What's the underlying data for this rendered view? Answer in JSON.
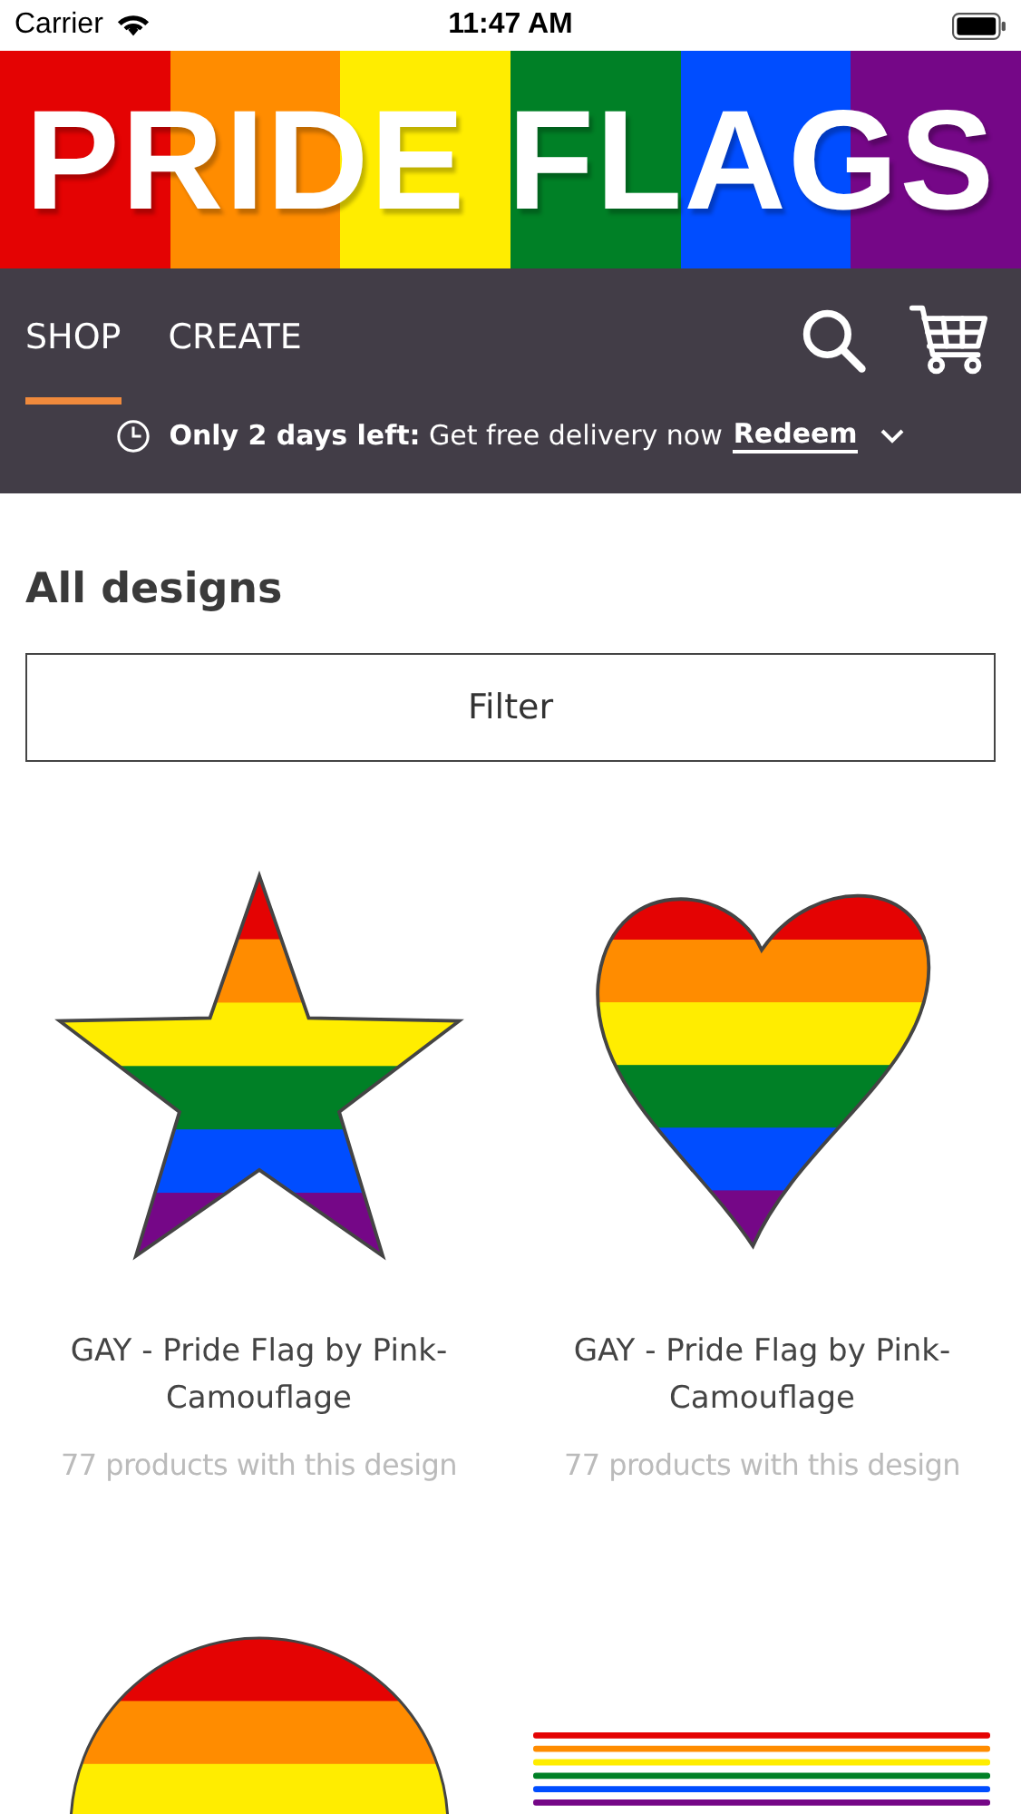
{
  "status_bar": {
    "carrier": "Carrier",
    "time": "11:47 AM"
  },
  "banner": {
    "title": "PRIDE FLAGS"
  },
  "tabs": [
    {
      "label": "SHOP",
      "selected": true
    },
    {
      "label": "CREATE",
      "selected": false
    }
  ],
  "promo": {
    "text": "**Only 2 days left:** Get free delivery now",
    "link": "Redeem"
  },
  "heading": "All designs",
  "filter_button": "Filter",
  "designs": [
    {
      "kind": "star",
      "title": "GAY - Pride Flag by Pink-Camouflage",
      "count": "77 products with this design"
    },
    {
      "kind": "heart",
      "title": "GAY - Pride Flag by Pink-Camouflage",
      "count": "77 products with this design"
    },
    {
      "kind": "circle"
    },
    {
      "kind": "lines"
    }
  ]
}
